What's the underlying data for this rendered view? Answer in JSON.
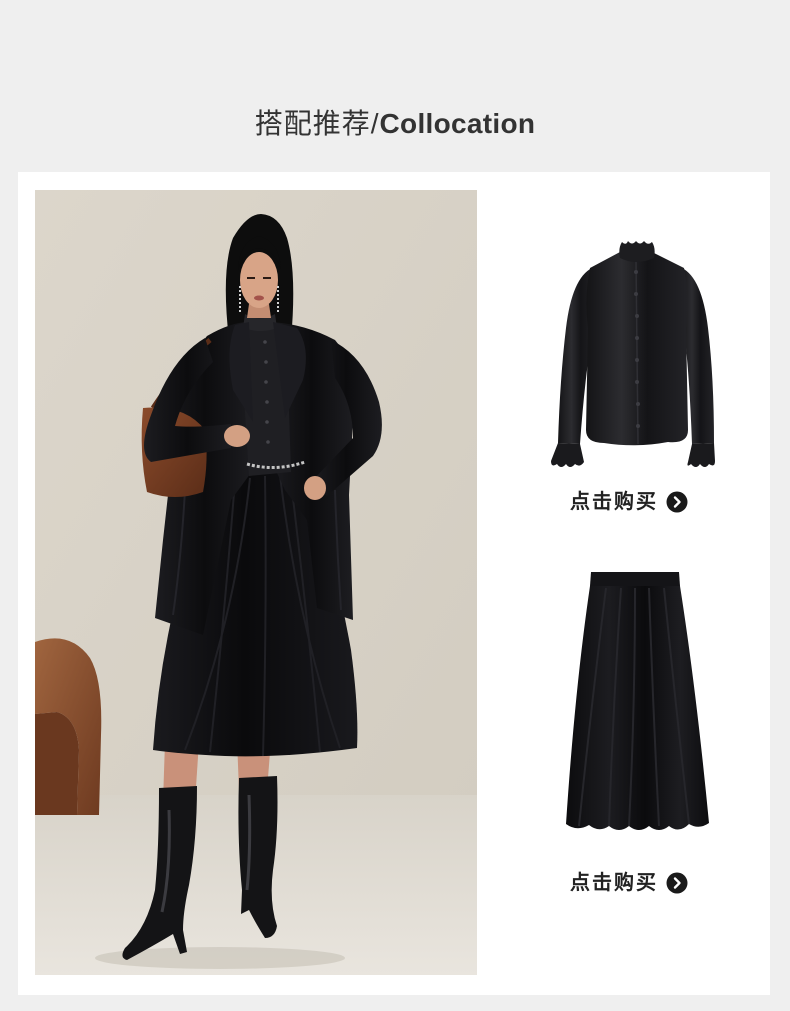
{
  "header": {
    "title_cn": "搭配推荐/",
    "title_en": "Collocation"
  },
  "products": [
    {
      "cta_label": "点击购买",
      "cta_icon": "arrow-right-circle-icon"
    },
    {
      "cta_label": "点击购买",
      "cta_icon": "arrow-right-circle-icon"
    }
  ],
  "colors": {
    "page_bg": "#efefef",
    "card_bg": "#ffffff",
    "title_text": "#333333",
    "cta_text": "#222222",
    "cta_icon_bg": "#1a1a1a"
  }
}
